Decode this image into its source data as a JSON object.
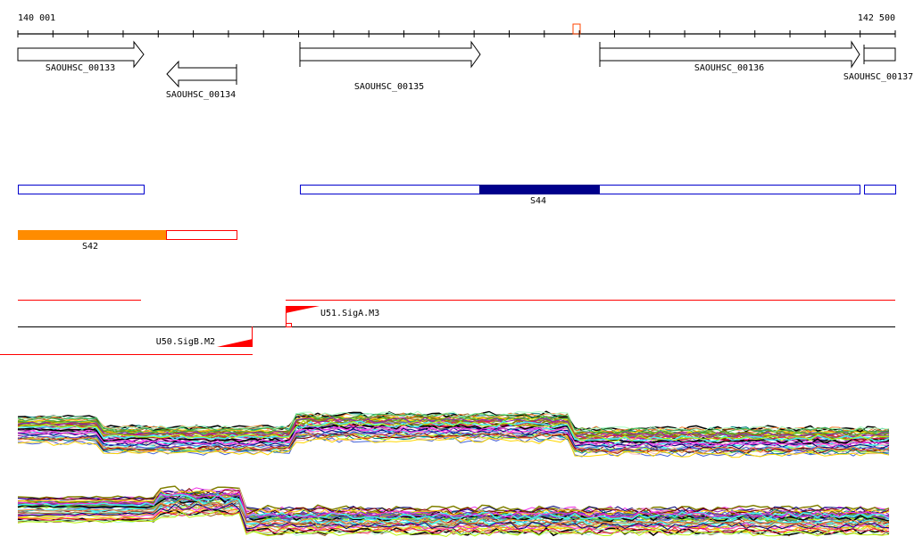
{
  "ruler": {
    "start_label": "140 001",
    "end_label": "142 500",
    "ticks": 25
  },
  "genes": [
    {
      "name": "SAOUHSC_00133",
      "strand": "+"
    },
    {
      "name": "SAOUHSC_00134",
      "strand": "-"
    },
    {
      "name": "SAOUHSC_00135",
      "strand": "+"
    },
    {
      "name": "SAOUHSC_00136",
      "strand": "+"
    },
    {
      "name": "SAOUHSC_00137",
      "strand": "+"
    }
  ],
  "segments": [
    {
      "name": "S44",
      "color": "#00008b"
    },
    {
      "name": "S42",
      "color": "#ff8c00"
    }
  ],
  "promoters": [
    {
      "name": "U51.SigA.M3",
      "color": "#ff0000"
    },
    {
      "name": "U50.SigB.M2",
      "color": "#ff0000"
    }
  ],
  "colors": {
    "outline_blue": "#0000cd",
    "outline_red": "#ff0000"
  }
}
